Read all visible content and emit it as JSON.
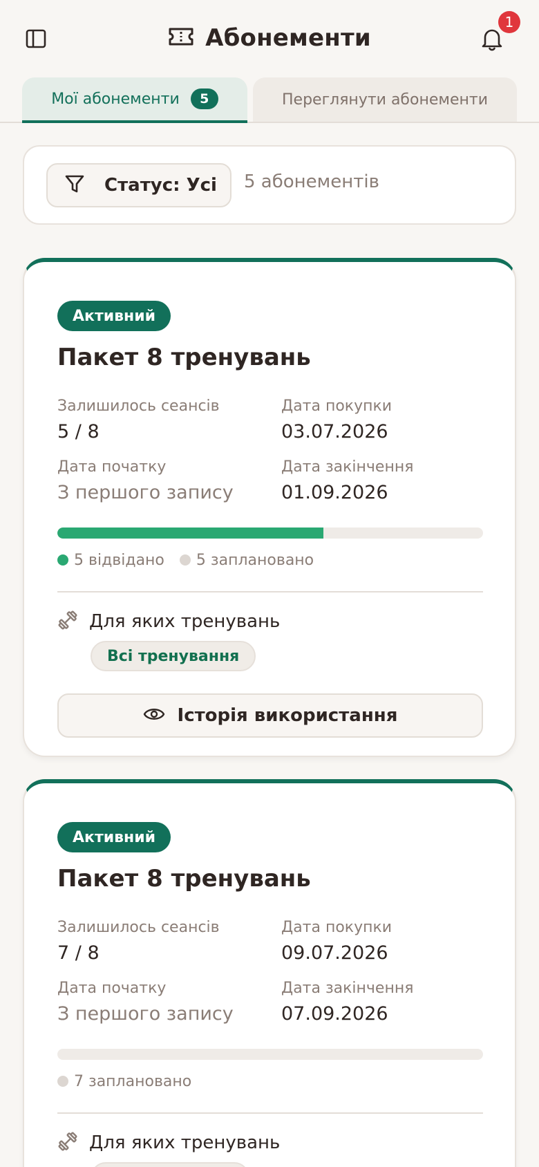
{
  "header": {
    "title": "Абонементи",
    "notification_count": "1"
  },
  "tabs": [
    {
      "label": "Мої абонементи",
      "count": "5",
      "active": true
    },
    {
      "label": "Переглянути абонементи",
      "active": false
    }
  ],
  "filter": {
    "label": "Статус: Усі",
    "count_text": "5 абонементів"
  },
  "labels": {
    "remaining": "Залишилось сеансів",
    "purchase_date": "Дата покупки",
    "start_date": "Дата початку",
    "end_date": "Дата закінчення",
    "for_trainings": "Для яких тренувань",
    "history_button": "Історія використання"
  },
  "cards": [
    {
      "status": "Активний",
      "title": "Пакет 8 тренувань",
      "remaining": "5 / 8",
      "purchase_date": "03.07.2026",
      "start_date": "З першого запису",
      "end_date": "01.09.2026",
      "progress_fraction": 0.625,
      "visited": "5 відвідано",
      "planned": "5 заплановано",
      "trainings_chip": "Всі тренування"
    },
    {
      "status": "Активний",
      "title": "Пакет 8 тренувань",
      "remaining": "7 / 8",
      "purchase_date": "09.07.2026",
      "start_date": "З першого запису",
      "end_date": "07.09.2026",
      "progress_fraction": 0,
      "planned": "7 заплановано"
    }
  ],
  "colors": {
    "accent": "#12705a",
    "progress_fill": "#2aa872",
    "badge_red": "#e0363c"
  }
}
